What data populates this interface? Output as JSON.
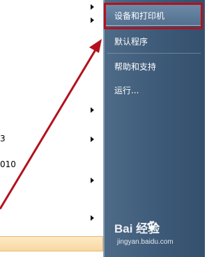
{
  "left_menu": {
    "items": [
      {
        "label": "",
        "has_submenu": true
      },
      {
        "label": "",
        "has_submenu": true
      },
      {
        "label": "3",
        "has_submenu": true
      },
      {
        "label": "010",
        "has_submenu": true
      },
      {
        "label": "",
        "has_submenu": true
      }
    ],
    "highlight_label": ""
  },
  "right_menu": {
    "items": [
      {
        "label": "设备和打印机"
      },
      {
        "label": "默认程序"
      },
      {
        "label": "帮助和支持"
      },
      {
        "label": "运行..."
      }
    ]
  },
  "watermark": {
    "brand": "Bai  经验",
    "url": "jingyan.baidu.com"
  },
  "annotation": {
    "color": "#b3111d"
  }
}
